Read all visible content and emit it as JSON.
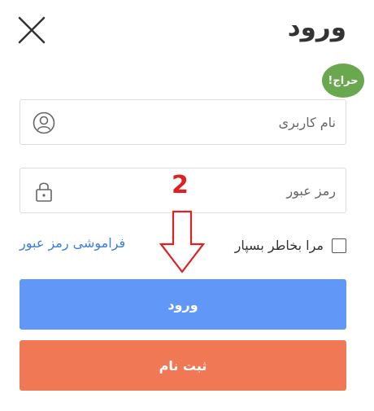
{
  "header": {
    "title": "ورود",
    "close_icon": "close-icon"
  },
  "badge": {
    "text": "حراج!",
    "color": "#6aa84f"
  },
  "form": {
    "username": {
      "placeholder": "نام کاربری",
      "value": "",
      "icon": "user-icon"
    },
    "password": {
      "placeholder": "رمز عبور",
      "value": "",
      "icon": "lock-icon"
    },
    "remember_label": "مرا بخاطر بسپار",
    "remember_checked": false,
    "forgot_link": "فراموشی رمز عبور"
  },
  "annotation": {
    "number": "2",
    "color": "#e02020",
    "icon": "arrow-down-icon"
  },
  "buttons": {
    "login_label": "ورود",
    "login_color": "#6198f8",
    "register_label": "ثبت نام",
    "register_color": "#f07855"
  }
}
